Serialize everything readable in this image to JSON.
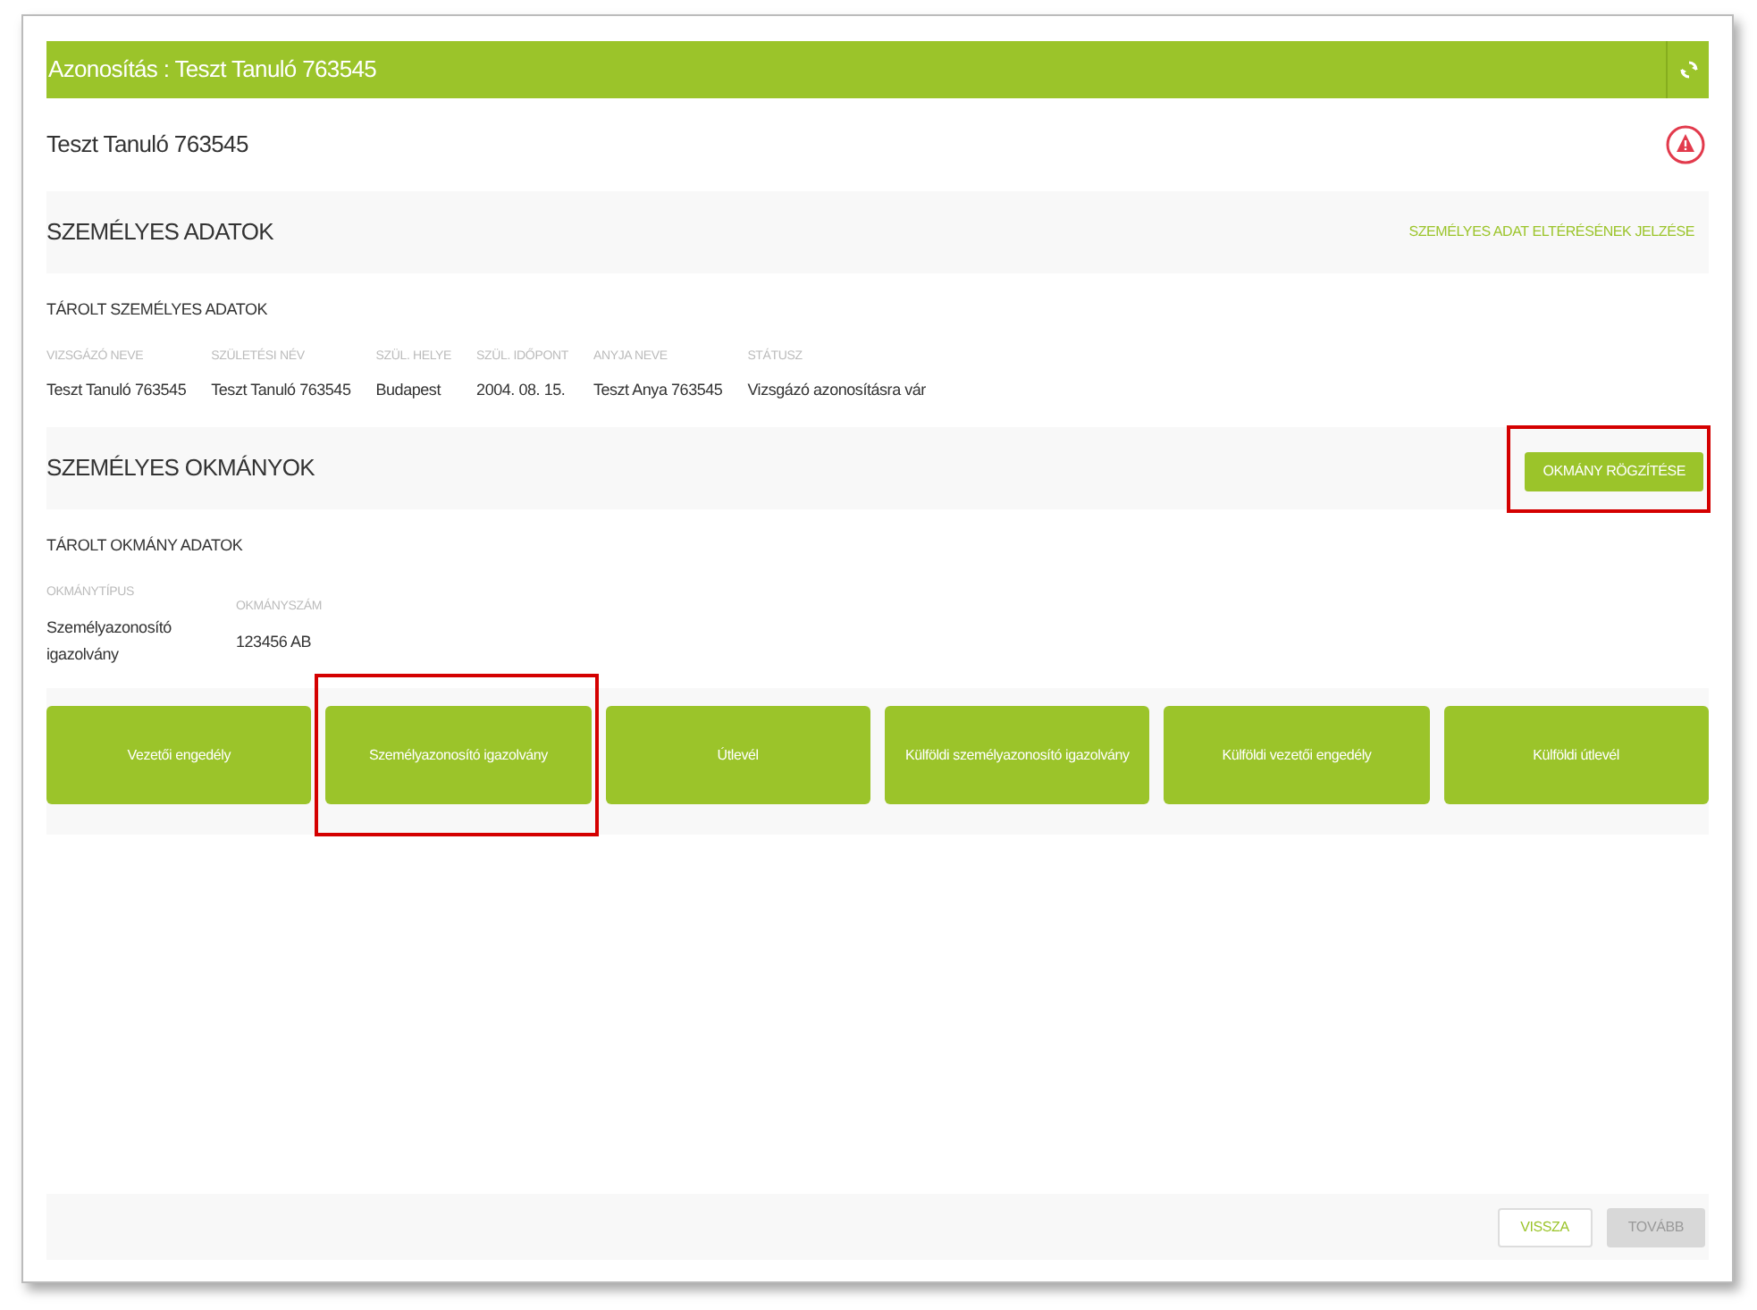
{
  "header": {
    "title": "Azonosítás : Teszt Tanuló 763545"
  },
  "candidate_name": "Teszt Tanuló 763545",
  "personal_section": {
    "title": "SZEMÉLYES ADATOK",
    "link": "SZEMÉLYES ADAT ELTÉRÉSÉNEK JELZÉSE",
    "subtitle": "TÁROLT SZEMÉLYES ADATOK",
    "fields": [
      {
        "label": "VIZSGÁZÓ NEVE",
        "value": "Teszt Tanuló 763545"
      },
      {
        "label": "SZÜLETÉSI NÉV",
        "value": "Teszt Tanuló 763545"
      },
      {
        "label": "SZÜL. HELYE",
        "value": "Budapest"
      },
      {
        "label": "SZÜL. IDŐPONT",
        "value": "2004. 08. 15."
      },
      {
        "label": "ANYJA NEVE",
        "value": "Teszt Anya 763545"
      },
      {
        "label": "STÁTUSZ",
        "value": "Vizsgázó azonosításra vár"
      }
    ]
  },
  "documents_section": {
    "title": "SZEMÉLYES OKMÁNYOK",
    "button": {
      "label": "OKMÁNY RÖGZÍTÉSE",
      "highlighted": true
    },
    "subtitle": "TÁROLT OKMÁNY ADATOK",
    "fields": [
      {
        "label": "OKMÁNYTÍPUS",
        "value": "Személyazonosító igazolvány"
      },
      {
        "label": "OKMÁNYSZÁM",
        "value": "123456 AB"
      }
    ]
  },
  "document_types": [
    {
      "label": "Vezetői engedély",
      "highlighted": false
    },
    {
      "label": "Személyazonosító igazolvány",
      "highlighted": true
    },
    {
      "label": "Útlevél",
      "highlighted": false
    },
    {
      "label": "Külföldi személyazonosító igazolvány",
      "highlighted": false
    },
    {
      "label": "Külföldi vezetői engedély",
      "highlighted": false
    },
    {
      "label": "Külföldi útlevél",
      "highlighted": false
    }
  ],
  "footer": {
    "buttons": [
      {
        "label": "VISSZA",
        "disabled": false
      },
      {
        "label": "TOVÁBB",
        "disabled": true
      }
    ]
  }
}
